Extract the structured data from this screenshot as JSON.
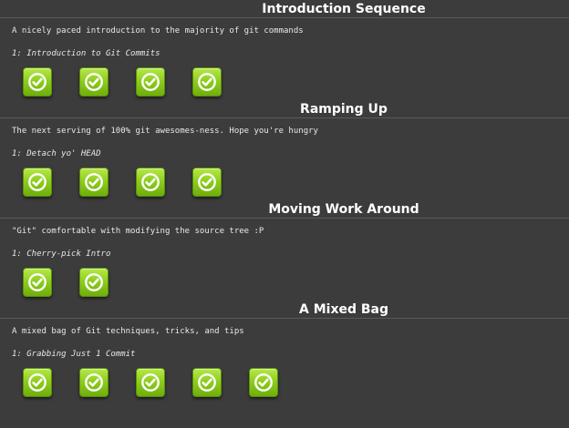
{
  "groups": [
    {
      "title": "Introduction Sequence",
      "description": "A nicely paced introduction to the majority of git commands",
      "level_name": "1: Introduction to Git Commits",
      "badge_icon": "check-circle-icon",
      "badge_count": 4
    },
    {
      "title": "Ramping Up",
      "description": "The next serving of 100% git awesomes-ness. Hope you're hungry",
      "level_name": "1: Detach yo' HEAD",
      "badge_icon": "check-circle-icon",
      "badge_count": 4
    },
    {
      "title": "Moving Work Around",
      "description": "\"Git\" comfortable with modifying the source tree :P",
      "level_name": "1: Cherry-pick Intro",
      "badge_icon": "check-circle-icon",
      "badge_count": 2
    },
    {
      "title": "A Mixed Bag",
      "description": "A mixed bag of Git techniques, tricks, and tips",
      "level_name": "1: Grabbing Just 1 Commit",
      "badge_icon": "check-circle-icon",
      "badge_count": 5
    }
  ],
  "colors": {
    "background": "#3c3c3c",
    "badge_green": "#8fce1f",
    "text": "#eeeeee"
  }
}
